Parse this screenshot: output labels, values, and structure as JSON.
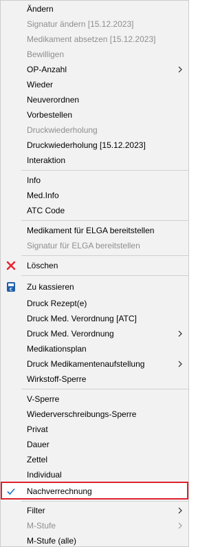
{
  "menu": {
    "items": [
      {
        "label": "Ändern",
        "disabled": false
      },
      {
        "label": "Signatur ändern [15.12.2023]",
        "disabled": true
      },
      {
        "label": "Medikament absetzen [15.12.2023]",
        "disabled": true
      },
      {
        "label": "Bewilligen",
        "disabled": true
      },
      {
        "label": "OP-Anzahl",
        "disabled": false,
        "submenu": true
      },
      {
        "label": "Wieder",
        "disabled": false
      },
      {
        "label": "Neuverordnen",
        "disabled": false
      },
      {
        "label": "Vorbestellen",
        "disabled": false
      },
      {
        "label": "Druckwiederholung",
        "disabled": true
      },
      {
        "label": "Druckwiederholung [15.12.2023]",
        "disabled": false
      },
      {
        "label": "Interaktion",
        "disabled": false
      },
      {
        "label": "Info",
        "disabled": false
      },
      {
        "label": "Med.Info",
        "disabled": false
      },
      {
        "label": "ATC Code",
        "disabled": false
      },
      {
        "label": "Medikament für ELGA bereitstellen",
        "disabled": false
      },
      {
        "label": "Signatur für ELGA bereitstellen",
        "disabled": true
      },
      {
        "label": "Löschen",
        "disabled": false,
        "icon": "red-x-delete-icon"
      },
      {
        "label": "Zu kassieren",
        "disabled": false,
        "icon": "cash-register-icon"
      },
      {
        "label": "Druck Rezept(e)",
        "disabled": false
      },
      {
        "label": "Druck Med. Verordnung [ATC]",
        "disabled": false
      },
      {
        "label": "Druck Med. Verordnung",
        "disabled": false,
        "submenu": true
      },
      {
        "label": "Medikationsplan",
        "disabled": false
      },
      {
        "label": "Druck Medikamentenaufstellung",
        "disabled": false,
        "submenu": true
      },
      {
        "label": "Wirkstoff-Sperre",
        "disabled": false
      },
      {
        "label": "V-Sperre",
        "disabled": false
      },
      {
        "label": "Wiederverschreibungs-Sperre",
        "disabled": false
      },
      {
        "label": "Privat",
        "disabled": false
      },
      {
        "label": "Dauer",
        "disabled": false
      },
      {
        "label": "Zettel",
        "disabled": false
      },
      {
        "label": "Individual",
        "disabled": false
      },
      {
        "label": "Nachverrechnung",
        "disabled": false,
        "checked": true,
        "highlighted": true
      },
      {
        "label": "Filter",
        "disabled": false,
        "submenu": true
      },
      {
        "label": "M-Stufe",
        "disabled": true,
        "submenu": true
      },
      {
        "label": "M-Stufe (alle)",
        "disabled": false
      }
    ]
  },
  "colors": {
    "menu_background": "#f2f2f2",
    "disabled_text": "#8e8e8e",
    "highlight_border": "#e0202e",
    "checkmark": "#1a6fc9",
    "delete_icon": "#e8202a",
    "cash_icon": "#1f5fa8"
  }
}
